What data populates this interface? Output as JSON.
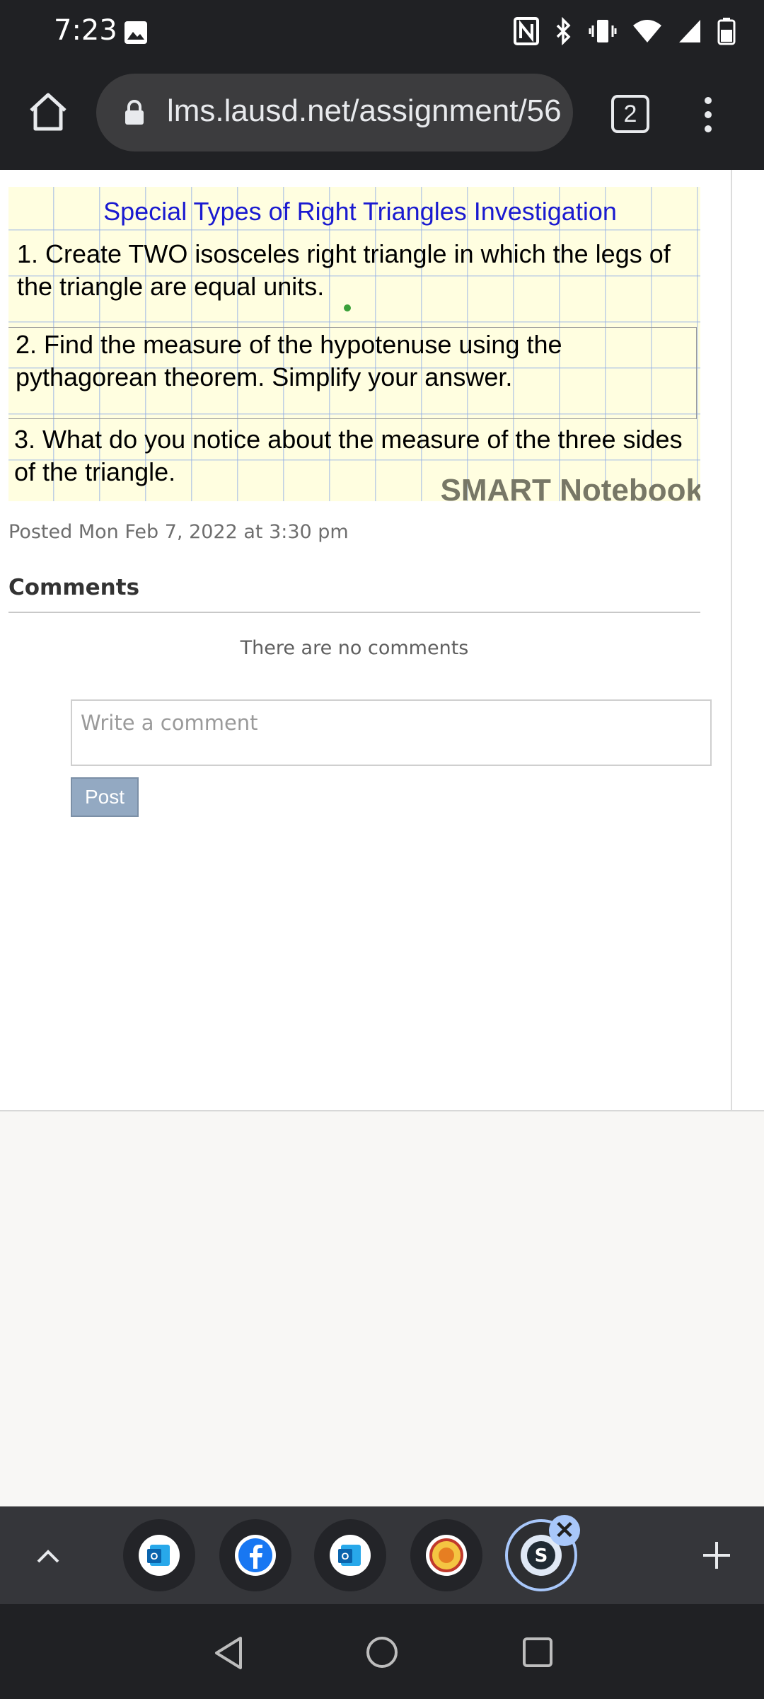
{
  "status_bar": {
    "time": "7:23"
  },
  "browser": {
    "url": "lms.lausd.net/assignment/56",
    "tab_count": "2"
  },
  "slide": {
    "title": "Special Types of Right Triangles Investigation",
    "question_1": "1. Create TWO isosceles right triangle in which the legs of the triangle are equal units.",
    "question_2": "2. Find the measure of the hypotenuse using the pythagorean theorem. Simplify your answer.",
    "question_3": "3. What do you notice about the measure of the three sides of the triangle.",
    "watermark": "SMART Notebook"
  },
  "post": {
    "posted_text": "Posted Mon Feb 7, 2022 at 3:30 pm"
  },
  "comments": {
    "heading": "Comments",
    "empty_text": "There are no comments",
    "input_placeholder": "Write a comment",
    "post_label": "Post"
  },
  "tab_strip": {
    "close_label": "✕",
    "add_label": "+"
  }
}
